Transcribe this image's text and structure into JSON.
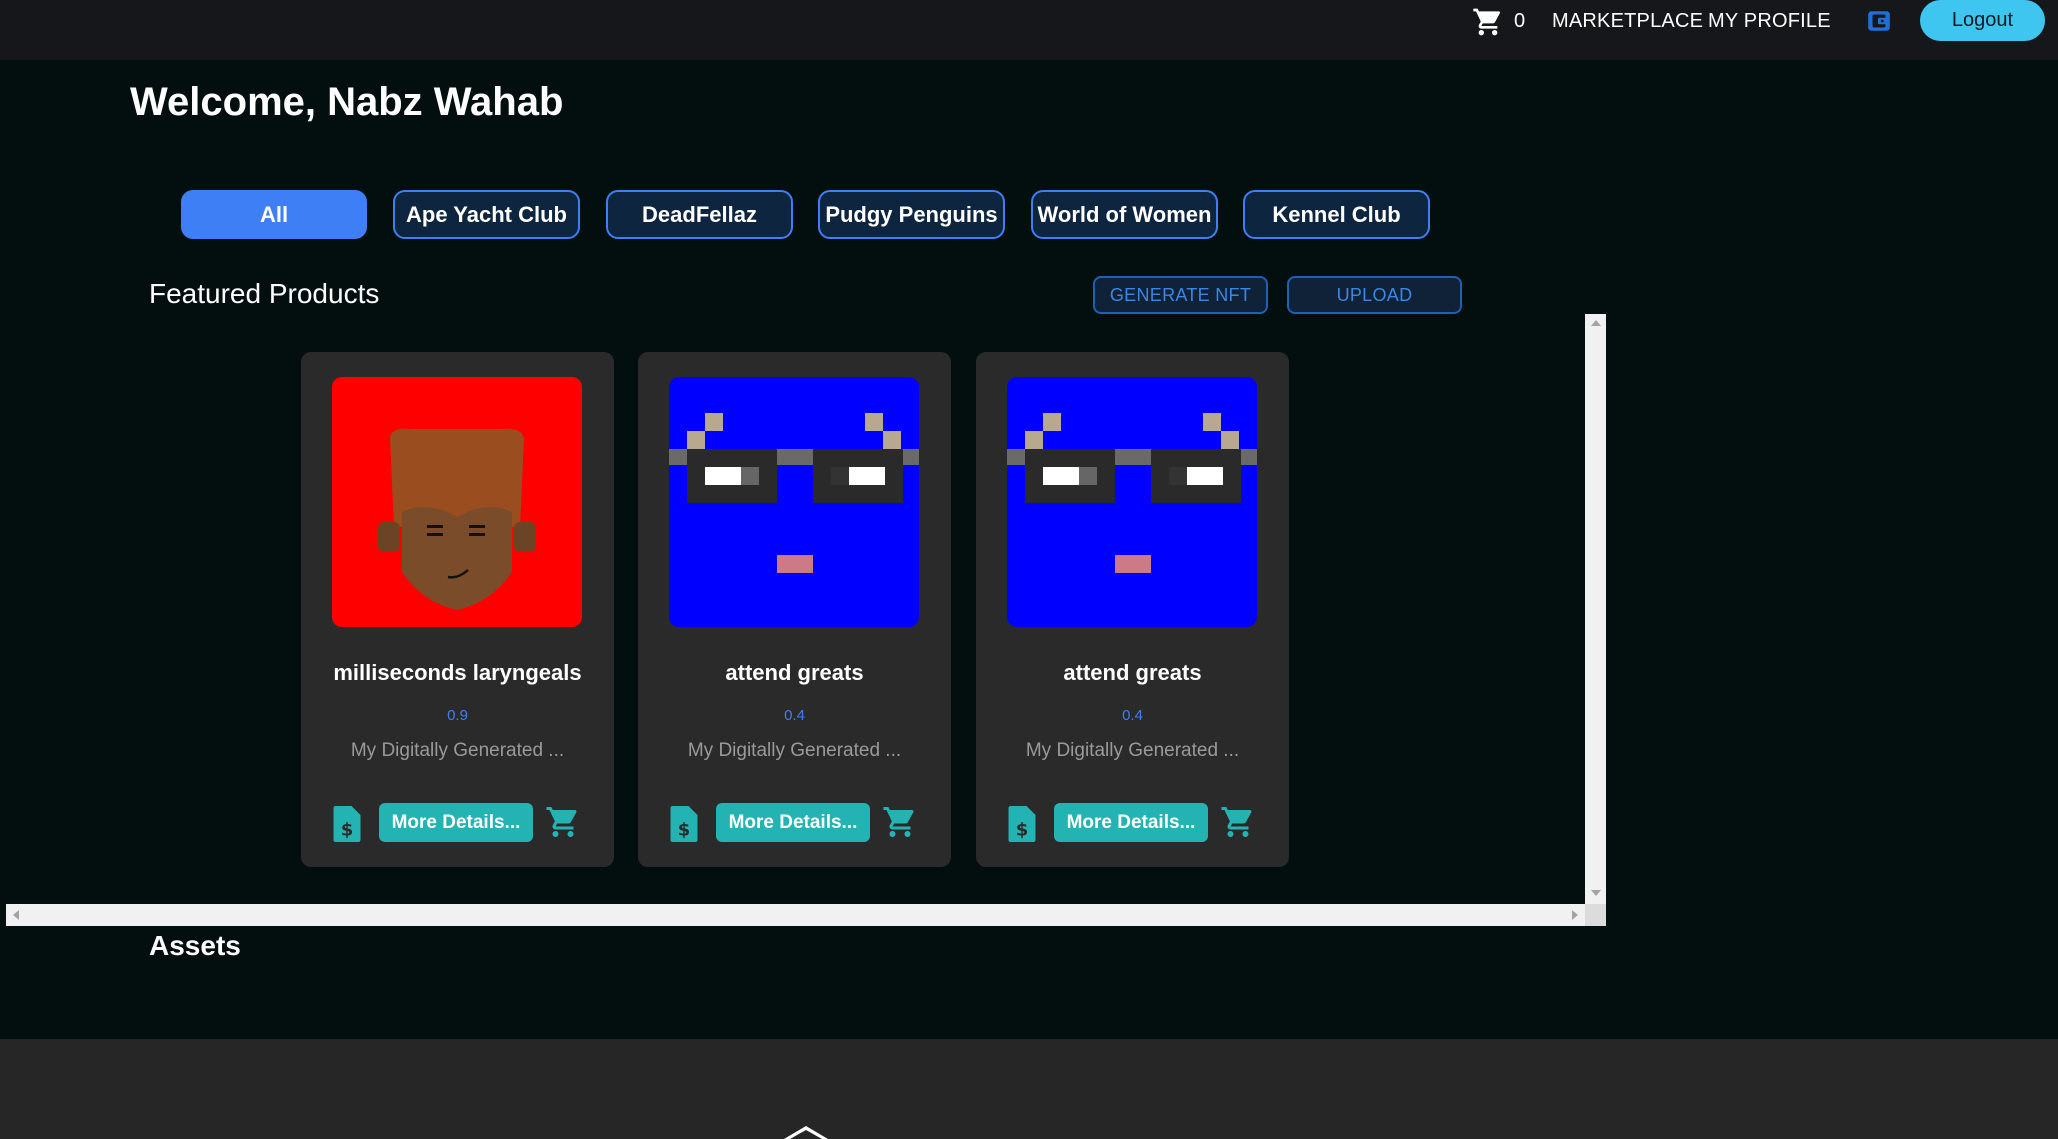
{
  "header": {
    "cart_count": "0",
    "nav_marketplace": "MARKETPLACE",
    "nav_profile": "MY PROFILE",
    "logout_label": "Logout",
    "icons": [
      "shopping-cart-icon",
      "wallet-icon"
    ]
  },
  "welcome": "Welcome, Nabz Wahab",
  "filters": [
    {
      "label": "All",
      "active": true
    },
    {
      "label": "Ape Yacht Club",
      "active": false
    },
    {
      "label": "DeadFellaz",
      "active": false
    },
    {
      "label": "Pudgy Penguins",
      "active": false
    },
    {
      "label": "World of Women",
      "active": false
    },
    {
      "label": "Kennel Club",
      "active": false
    }
  ],
  "featured": {
    "title": "Featured Products",
    "generate_label": "GENERATE NFT",
    "upload_label": "UPLOAD"
  },
  "products": [
    {
      "name": "milliseconds laryngeals",
      "price": "0.9",
      "description": "My Digitally Generated ...",
      "details_label": "More Details...",
      "bg_color": "#fe0000"
    },
    {
      "name": "attend greats",
      "price": "0.4",
      "description": "My Digitally Generated ...",
      "details_label": "More Details...",
      "bg_color": "#0000fe"
    },
    {
      "name": "attend greats",
      "price": "0.4",
      "description": "My Digitally Generated ...",
      "details_label": "More Details...",
      "bg_color": "#0000fe"
    }
  ],
  "assets_title": "Assets",
  "colors": {
    "accent_blue": "#3e7ff6",
    "teal": "#24b3b3",
    "logout_bg": "#3ec6f0",
    "page_bg": "#030f0f"
  }
}
